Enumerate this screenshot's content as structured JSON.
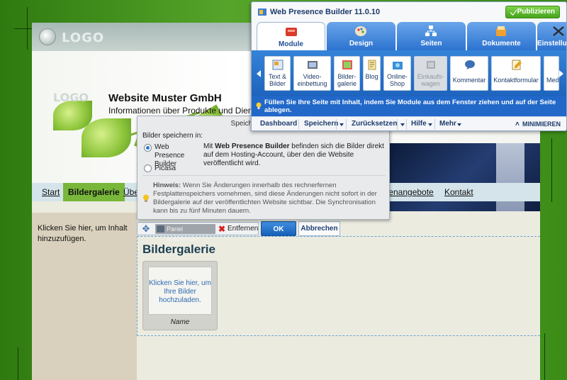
{
  "site": {
    "logo_text": "LOGO",
    "header_logo_text": "LOGO",
    "title": "Website Muster GmbH",
    "subtitle": "Informationen über Produkte und Dien",
    "nav": [
      "Start",
      "Bildergalerie",
      "Über",
      "llenangebote",
      "Kontakt"
    ],
    "left_hint": "Klicken Sie hier, um Inhalt hinzuzufügen.",
    "gallery_heading": "Bildergalerie",
    "upload_text": "Klicken Sie hier, um Ihre Bilder hochzuladen.",
    "upload_name": "Name"
  },
  "element_toolbar": {
    "hide_panel": "Panel ausblenden",
    "remove": "Entfernen",
    "ok": "OK",
    "cancel": "Abbrechen"
  },
  "popup": {
    "title": "Speicherort für Bilder",
    "label": "Bilder speichern in:",
    "options": [
      {
        "label": "Web Presence Builder",
        "selected": true
      },
      {
        "label": "Picasa",
        "selected": false
      }
    ],
    "description_bold": "Web Presence Builder",
    "description_pre": "Mit ",
    "description_post": " befinden sich die Bilder direkt auf dem Hosting-Account, über den die Website veröffentlicht wird.",
    "hint_bold": "Hinweis:",
    "hint_text": " Wenn Sie Änderungen innerhalb des rechnerfernen Festplattenspeichers vornehmen, sind diese Änderungen nicht sofort in der Bildergalerie auf der veröffentlichten Website sichtbar. Die Synchronisation kann bis zu fünf Minuten dauern."
  },
  "wpb": {
    "title": "Web Presence Builder 11.0.10",
    "publish": "Publizieren",
    "tabs": [
      {
        "label": "Module",
        "icon": "module-icon",
        "active": true
      },
      {
        "label": "Design",
        "icon": "palette-icon",
        "active": false
      },
      {
        "label": "Seiten",
        "icon": "sitemap-icon",
        "active": false
      },
      {
        "label": "Dokumente",
        "icon": "documents-icon",
        "active": false
      },
      {
        "label": "Einstellungen",
        "icon": "tools-icon",
        "active": false
      }
    ],
    "modules": [
      {
        "label1": "Text &",
        "label2": "Bilder",
        "icon": "text-image-icon",
        "enabled": true
      },
      {
        "label1": "Video-",
        "label2": "einbettung",
        "icon": "video-icon",
        "enabled": true
      },
      {
        "label1": "Bilder-",
        "label2": "galerie",
        "icon": "gallery-icon",
        "enabled": true
      },
      {
        "label1": "Blog",
        "label2": "",
        "icon": "blog-icon",
        "enabled": true
      },
      {
        "label1": "Online-",
        "label2": "Shop",
        "icon": "shop-icon",
        "enabled": true
      },
      {
        "label1": "Einkaufs-",
        "label2": "wagen",
        "icon": "cart-icon",
        "enabled": false
      },
      {
        "label1": "Kommentar",
        "label2": "",
        "icon": "comment-icon",
        "enabled": true
      },
      {
        "label1": "Kontaktformular",
        "label2": "",
        "icon": "contact-form-icon",
        "enabled": true
      },
      {
        "label1": "Med",
        "label2": "",
        "icon": "media-icon",
        "enabled": true
      }
    ],
    "hint": "Füllen Sie Ihre Seite mit Inhalt, indem Sie Module aus dem Fenster ziehen und auf der Seite ablegen.",
    "menu": {
      "dashboard": "Dashboard",
      "save": "Speichern",
      "undo": "Zurücksetzen",
      "help": "Hilfe",
      "more": "Mehr",
      "minimize": "MINIMIEREN"
    }
  },
  "colors": {
    "accent_blue": "#2c73d0",
    "publish_green": "#46a41c",
    "nav_active": "#78b73a"
  }
}
